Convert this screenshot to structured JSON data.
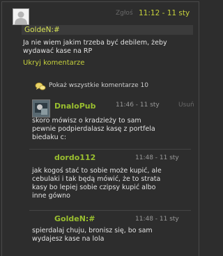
{
  "top_comment": {
    "report_label": "Zgłoś",
    "time": "11:12 - 11 sty",
    "author": "GoldeN:#",
    "text": "Ja nie wiem jakim trzeba być debilem, żeby wydawać kase na RP",
    "hide_label": "Ukryj komentarze",
    "avatar_icon": "default-avatar-icon"
  },
  "show_all": {
    "label": "Pokaż wszystkie komentarze 10",
    "icon": "comments-icon"
  },
  "replies": [
    {
      "author": "DnaloPub",
      "time": "11:46 - 11 sty",
      "delete_label": "Usuń",
      "text": "skoro mówisz o kradzieży to sam\npewnie podpierdalasz kasę z portfela\nbiedaku c:",
      "avatar_icon": "user-avatar-icon"
    },
    {
      "author": "dordo112",
      "time": "11:48 - 11 sty",
      "text": "jak kogoś stać to sobie może kupić, ale\ncebulaki i tak będą mówić, że to strata\nkasy bo lepiej sobie czipsy kupić albo\ninne gówno"
    },
    {
      "author": "GoldeN:#",
      "time": "11:48 - 11 sty",
      "text": "spierdalaj chuju, bronisz się, bo sam\nwydajesz kase na lola"
    }
  ],
  "colors": {
    "background": "#2d2d2d",
    "accent_yellow": "#c7d23c",
    "reply_name_green": "#9abf2f"
  }
}
